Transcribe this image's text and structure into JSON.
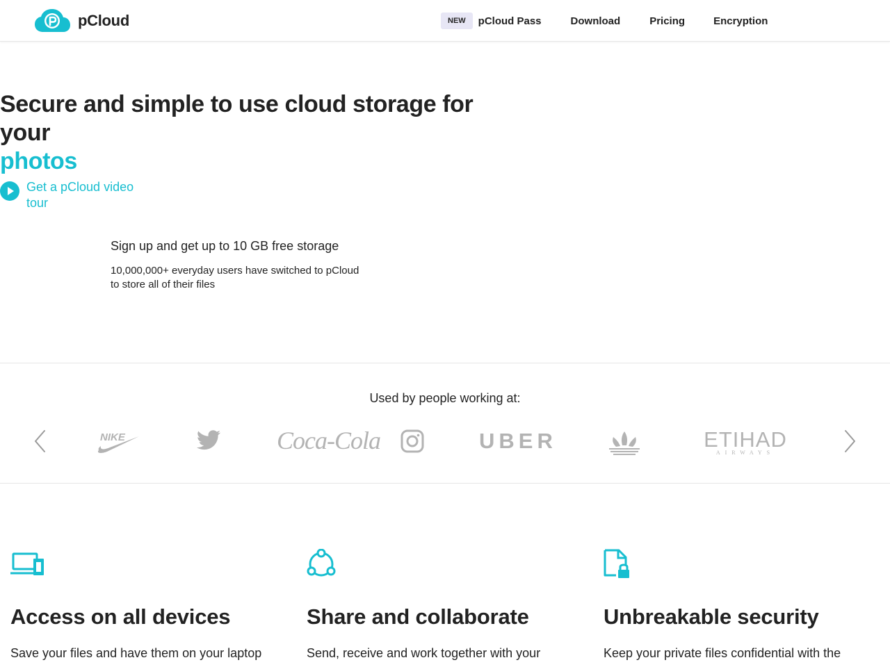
{
  "header": {
    "logo_text": "pCloud",
    "nav": {
      "badge": "NEW",
      "items": [
        "pCloud Pass",
        "Download",
        "Pricing",
        "Encryption"
      ]
    }
  },
  "hero": {
    "title": "Secure and simple to use cloud storage for your",
    "title_accent": "photos",
    "video_tour": "Get a pCloud video tour",
    "signup_title": "Sign up and get up to 10 GB free storage",
    "signup_sub": "10,000,000+ everyday users have switched to pCloud to store all of their files"
  },
  "logos": {
    "heading": "Used by people working at:",
    "brands": [
      {
        "name": "nike-logo",
        "text": "NIKE"
      },
      {
        "name": "twitter-logo",
        "text": ""
      },
      {
        "name": "coca-cola-logo",
        "text": "Coca-Cola"
      },
      {
        "name": "instagram-logo",
        "text": ""
      },
      {
        "name": "uber-logo",
        "text": "UBER"
      },
      {
        "name": "adidas-logo",
        "text": ""
      },
      {
        "name": "etihad-logo",
        "text": "ETIHAD",
        "sub": "AIRWAYS"
      }
    ]
  },
  "features": [
    {
      "icon": "devices-icon",
      "title": "Access on all devices",
      "desc_before": "Save your files and have them on your laptop",
      "desc_link": "",
      "desc_after": ""
    },
    {
      "icon": "share-icon",
      "title": "Share and collaborate",
      "desc_before": "Send, receive and work together with your",
      "desc_link": "",
      "desc_after": ""
    },
    {
      "icon": "secure-file-icon",
      "title": "Unbreakable security",
      "desc_before": "Keep your private files confidential with the",
      "desc_link": "",
      "desc_after": ""
    }
  ],
  "colors": {
    "accent": "#17bed0",
    "text": "#222222",
    "badge_bg": "#e7e6f5",
    "logo_gray": "#b3b3b3"
  }
}
